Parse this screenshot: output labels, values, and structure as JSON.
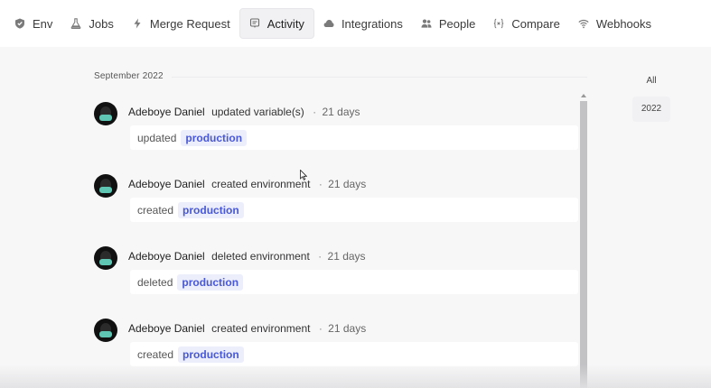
{
  "nav": {
    "tabs": [
      {
        "label": "Env",
        "icon": "shield-icon"
      },
      {
        "label": "Jobs",
        "icon": "flask-icon"
      },
      {
        "label": "Merge Request",
        "icon": "lightning-icon"
      },
      {
        "label": "Activity",
        "icon": "activity-icon",
        "active": true
      },
      {
        "label": "Integrations",
        "icon": "cloud-icon"
      },
      {
        "label": "People",
        "icon": "people-icon"
      },
      {
        "label": "Compare",
        "icon": "brackets-icon"
      },
      {
        "label": "Webhooks",
        "icon": "wifi-icon"
      }
    ]
  },
  "activity": {
    "month": "September 2022",
    "entries": [
      {
        "user": "Adeboye Daniel",
        "action": "updated variable(s)",
        "time": "21 days",
        "verb": "updated",
        "target": "production"
      },
      {
        "user": "Adeboye Daniel",
        "action": "created environment",
        "time": "21 days",
        "verb": "created",
        "target": "production"
      },
      {
        "user": "Adeboye Daniel",
        "action": "deleted environment",
        "time": "21 days",
        "verb": "deleted",
        "target": "production"
      },
      {
        "user": "Adeboye Daniel",
        "action": "created environment",
        "time": "21 days",
        "verb": "created",
        "target": "production"
      }
    ]
  },
  "filters": {
    "all_label": "All",
    "years": [
      "2022"
    ]
  },
  "colors": {
    "tag_text": "#4858d6",
    "tag_bg": "#eceefb",
    "avatar_mask": "#5ec6b2"
  }
}
